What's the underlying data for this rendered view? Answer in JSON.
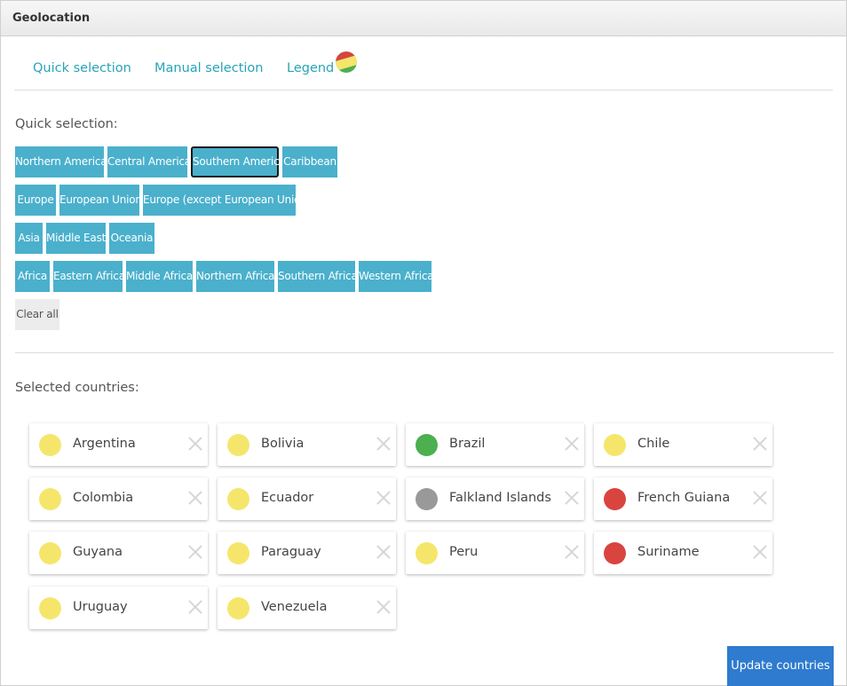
{
  "panel": {
    "title": "Geolocation"
  },
  "tabs": [
    {
      "label": "Quick selection"
    },
    {
      "label": "Manual selection"
    },
    {
      "label": "Legend"
    }
  ],
  "quick": {
    "label": "Quick selection:",
    "rows": [
      [
        "Northern America",
        "Central America",
        "Southern America",
        "Caribbean"
      ],
      [
        "Europe",
        "European Union",
        "Europe (except European Union)"
      ],
      [
        "Asia",
        "Middle East",
        "Oceania"
      ],
      [
        "Africa",
        "Eastern Africa",
        "Middle Africa",
        "Northern Africa",
        "Southern Africa",
        "Western Africa"
      ]
    ],
    "active": "Southern America",
    "clear_label": "Clear all"
  },
  "selected": {
    "label": "Selected countries:",
    "countries": [
      {
        "name": "Argentina",
        "status_color": "#f5e66b"
      },
      {
        "name": "Bolivia",
        "status_color": "#f5e66b"
      },
      {
        "name": "Brazil",
        "status_color": "#4caf50"
      },
      {
        "name": "Chile",
        "status_color": "#f5e66b"
      },
      {
        "name": "Colombia",
        "status_color": "#f5e66b"
      },
      {
        "name": "Ecuador",
        "status_color": "#f5e66b"
      },
      {
        "name": "Falkland Islands",
        "status_color": "#999999"
      },
      {
        "name": "French Guiana",
        "status_color": "#d9443f"
      },
      {
        "name": "Guyana",
        "status_color": "#f5e66b"
      },
      {
        "name": "Paraguay",
        "status_color": "#f5e66b"
      },
      {
        "name": "Peru",
        "status_color": "#f5e66b"
      },
      {
        "name": "Suriname",
        "status_color": "#d9443f"
      },
      {
        "name": "Uruguay",
        "status_color": "#f5e66b"
      },
      {
        "name": "Venezuela",
        "status_color": "#f5e66b"
      }
    ]
  },
  "update_label": "Update countries",
  "colors": {
    "accent": "#28a3b8",
    "quick_button": "#4ab0cc",
    "primary_button": "#2e7bcf"
  }
}
